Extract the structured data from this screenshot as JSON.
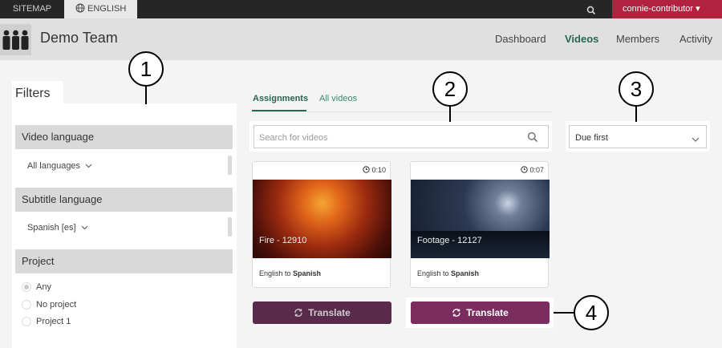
{
  "topbar": {
    "sitemap": "SITEMAP",
    "language": "ENGLISH",
    "user": "connie-contributor ▾"
  },
  "header": {
    "team": "Demo Team",
    "nav": [
      "Dashboard",
      "Videos",
      "Members",
      "Activity"
    ],
    "active_nav": "Videos"
  },
  "filters": {
    "title": "Filters",
    "video_language": {
      "heading": "Video language",
      "value": "All languages"
    },
    "subtitle_language": {
      "heading": "Subtitle language",
      "value": "Spanish [es]"
    },
    "project": {
      "heading": "Project",
      "options": [
        "Any",
        "No project",
        "Project 1"
      ],
      "selected": "Any"
    }
  },
  "tabs": {
    "assignments": "Assignments",
    "all_videos": "All videos",
    "active": "Assignments"
  },
  "search": {
    "placeholder": "Search for videos"
  },
  "sort": {
    "value": "Due first"
  },
  "videos": [
    {
      "title": "Fire - 12910",
      "duration": "0:10",
      "from": "English to ",
      "to": "Spanish",
      "button": "Translate"
    },
    {
      "title": "Footage - 12127",
      "duration": "0:07",
      "from": "English to ",
      "to": "Spanish",
      "button": "Translate"
    }
  ],
  "callouts": [
    "1",
    "2",
    "3",
    "4"
  ],
  "colors": {
    "brand_green": "#27664f",
    "user_red": "#b2213d",
    "button_purple": "#7b2c5f"
  }
}
